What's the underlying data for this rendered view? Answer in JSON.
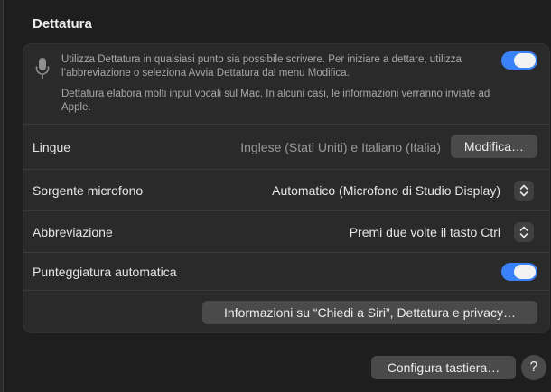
{
  "section": {
    "title": "Dettatura"
  },
  "info": {
    "icon": "microphone-icon",
    "paragraph1": "Utilizza Dettatura in qualsiasi punto sia possibile scrivere. Per iniziare a dettare, utilizza l’abbreviazione o seleziona Avvia Dettatura dal menu Modifica.",
    "paragraph2": "Dettatura elabora molti input vocali sul Mac. In alcuni casi, le informazioni verranno inviate ad Apple.",
    "toggle_on": true
  },
  "rows": {
    "languages": {
      "label": "Lingue",
      "value": "Inglese (Stati Uniti) e Italiano (Italia)",
      "button": "Modifica…"
    },
    "mic_source": {
      "label": "Sorgente microfono",
      "value": "Automatico (Microfono di Studio Display)"
    },
    "shortcut": {
      "label": "Abbreviazione",
      "value": "Premi due volte il tasto Ctrl"
    },
    "auto_punctuation": {
      "label": "Punteggiatura automatica",
      "toggle_on": true
    },
    "about": {
      "button": "Informazioni su “Chiedi a Siri”, Dettatura e privacy…"
    }
  },
  "footer": {
    "keyboard_button": "Configura tastiera…",
    "help_button": "?"
  },
  "colors": {
    "accent": "#3a82f7",
    "background": "#1e1e1e",
    "panel": "#2a2a2a"
  }
}
